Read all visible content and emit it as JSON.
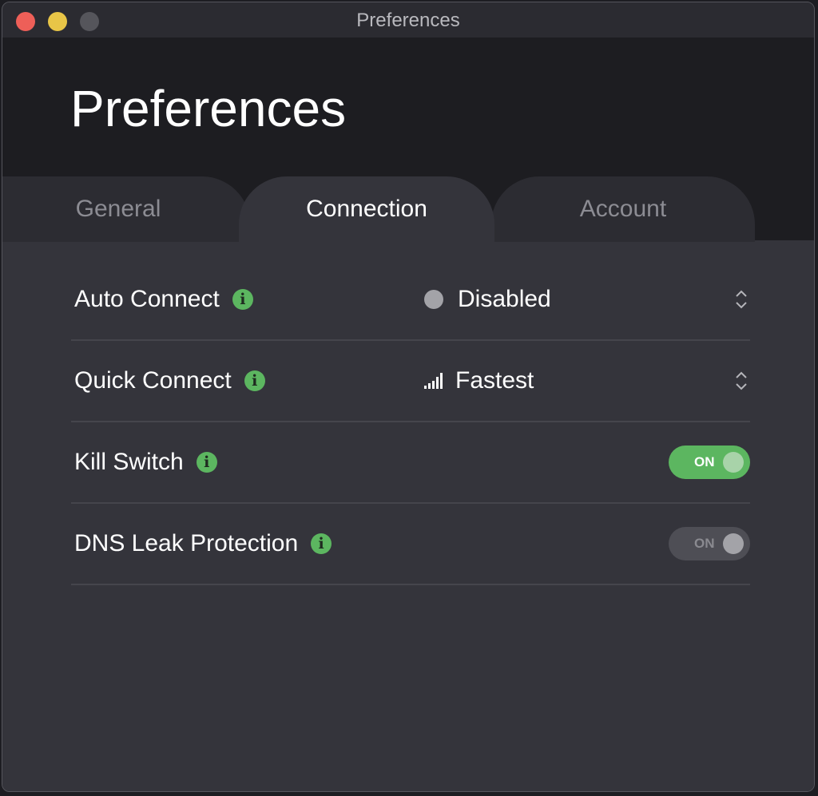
{
  "window": {
    "title": "Preferences",
    "controls": [
      "close",
      "minimize",
      "zoom"
    ]
  },
  "header": {
    "title": "Preferences"
  },
  "tabs": [
    {
      "label": "General",
      "active": false
    },
    {
      "label": "Connection",
      "active": true
    },
    {
      "label": "Account",
      "active": false
    }
  ],
  "settings": [
    {
      "label": "Auto Connect",
      "info_icon": "info-icon",
      "type": "select",
      "value": "Disabled",
      "value_icon": "status-dot-icon"
    },
    {
      "label": "Quick Connect",
      "info_icon": "info-icon",
      "type": "select",
      "value": "Fastest",
      "value_icon": "signal-bars-icon"
    },
    {
      "label": "Kill Switch",
      "info_icon": "info-icon",
      "type": "toggle",
      "toggle_label": "ON",
      "state": "on-enabled"
    },
    {
      "label": "DNS Leak Protection",
      "info_icon": "info-icon",
      "type": "toggle",
      "toggle_label": "ON",
      "state": "on-disabled"
    }
  ],
  "info_glyph": "i",
  "colors": {
    "accent_green": "#5cb660",
    "close": "#ee5f58",
    "minimize": "#e8c547",
    "zoom_inactive": "#55555b"
  }
}
